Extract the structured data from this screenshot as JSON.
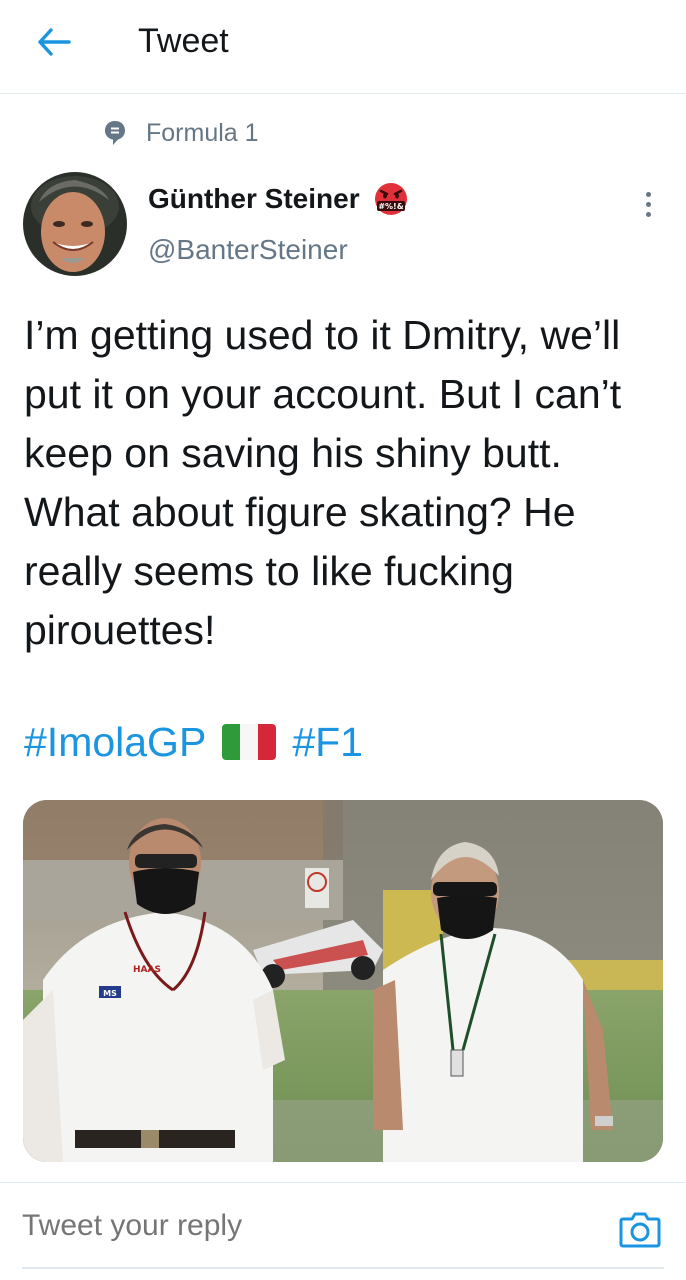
{
  "header": {
    "title": "Tweet",
    "back_icon": "arrow-left-icon"
  },
  "context": {
    "icon": "topic-icon",
    "label": "Formula 1"
  },
  "author": {
    "name": "Günther Steiner",
    "handle": "@BanterSteiner",
    "badge_emoji": "face-with-symbols-on-mouth"
  },
  "tweet": {
    "text": "I’m getting used to it Dmitry, we’ll put it on your account. But I can’t keep on saving his shiny butt. What about figure skating? He really seems to like fucking pirouettes!",
    "hashtags": [
      "#ImolaGP",
      "#F1"
    ],
    "flag": "italy-flag"
  },
  "media": {
    "shirt_logo_text": "HAAS"
  },
  "reply": {
    "placeholder": "Tweet your reply",
    "camera_icon": "camera-icon"
  },
  "colors": {
    "accent": "#1b95e0",
    "secondary_text": "#657786",
    "border": "#e1e8ed"
  }
}
